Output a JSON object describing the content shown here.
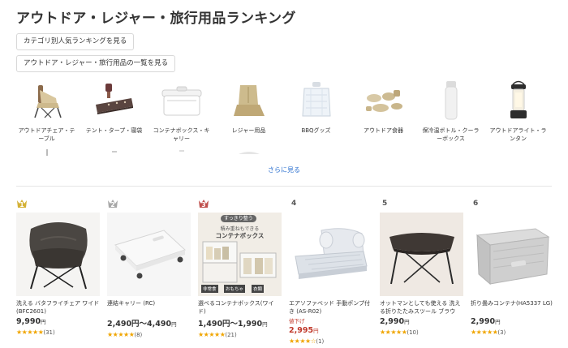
{
  "page_title": "アウトドア・レジャー・旅行用品ランキング",
  "buttons": {
    "category_ranking": "カテゴリ別人気ランキングを見る",
    "list_view": "アウトドア・レジャー・旅行用品の一覧を見る"
  },
  "categories": [
    {
      "label": "アウトドアチェア・テーブル",
      "icon": "outdoor-chair"
    },
    {
      "label": "テント・タープ・寝袋",
      "icon": "sleeping-bag"
    },
    {
      "label": "コンテナボックス・キャリー",
      "icon": "cooler-box"
    },
    {
      "label": "レジャー用品",
      "icon": "leisure-seat"
    },
    {
      "label": "BBQグッズ",
      "icon": "water-tank"
    },
    {
      "label": "アウトドア食器",
      "icon": "tableware-set"
    },
    {
      "label": "保冷温ボトル・クーラーボックス",
      "icon": "thermos-bottle"
    },
    {
      "label": "アウトドアライト・ランタン",
      "icon": "lantern"
    }
  ],
  "more_link": "さらに見る",
  "ranking": [
    {
      "rank": "1",
      "crown_color": "#d4b136",
      "name": "洗える バタフライチェア ワイド(BFC2601)",
      "discount": "",
      "price": "9,990",
      "yen": "円",
      "stars": "★★★★★",
      "reviews": "(31)",
      "price_red": false
    },
    {
      "rank": "2",
      "crown_color": "#a8a8a8",
      "name": "連結キャリー (RC)",
      "discount": "",
      "price": "2,490円～4,490",
      "yen": "円",
      "stars": "★★★★★",
      "reviews": "(8)",
      "price_red": false
    },
    {
      "rank": "3",
      "crown_color": "#c0504d",
      "name": "選べるコンテナボックス(ワイド)",
      "discount": "",
      "price": "1,490円～1,990",
      "yen": "円",
      "stars": "★★★★★",
      "reviews": "(21)",
      "price_red": false
    },
    {
      "rank": "4",
      "crown_color": "",
      "name": "エアソファベッド 手動ポンプ付き (AS-R02)",
      "discount": "値下げ",
      "price": "2,995",
      "yen": "円",
      "stars": "★★★★☆",
      "reviews": "(1)",
      "price_red": true
    },
    {
      "rank": "5",
      "crown_color": "",
      "name": "オットマンとしても使える 洗える折りたたみスツール ブラウン…",
      "discount": "",
      "price": "2,990",
      "yen": "円",
      "stars": "★★★★★",
      "reviews": "(10)",
      "price_red": false
    },
    {
      "rank": "6",
      "crown_color": "",
      "name": "折り畳みコンテナ(HA5337 LG)",
      "discount": "",
      "price": "2,990",
      "yen": "円",
      "stars": "★★★★★",
      "reviews": "(3)",
      "price_red": false
    }
  ],
  "product_image_texts": {
    "banner_top": "すっきり整う",
    "banner_mid": "積み重ねもできる",
    "banner_bottom": "コンテナボックス",
    "tag1": "非常食",
    "tag2": "おもちゃ",
    "tag3": "衣類"
  }
}
